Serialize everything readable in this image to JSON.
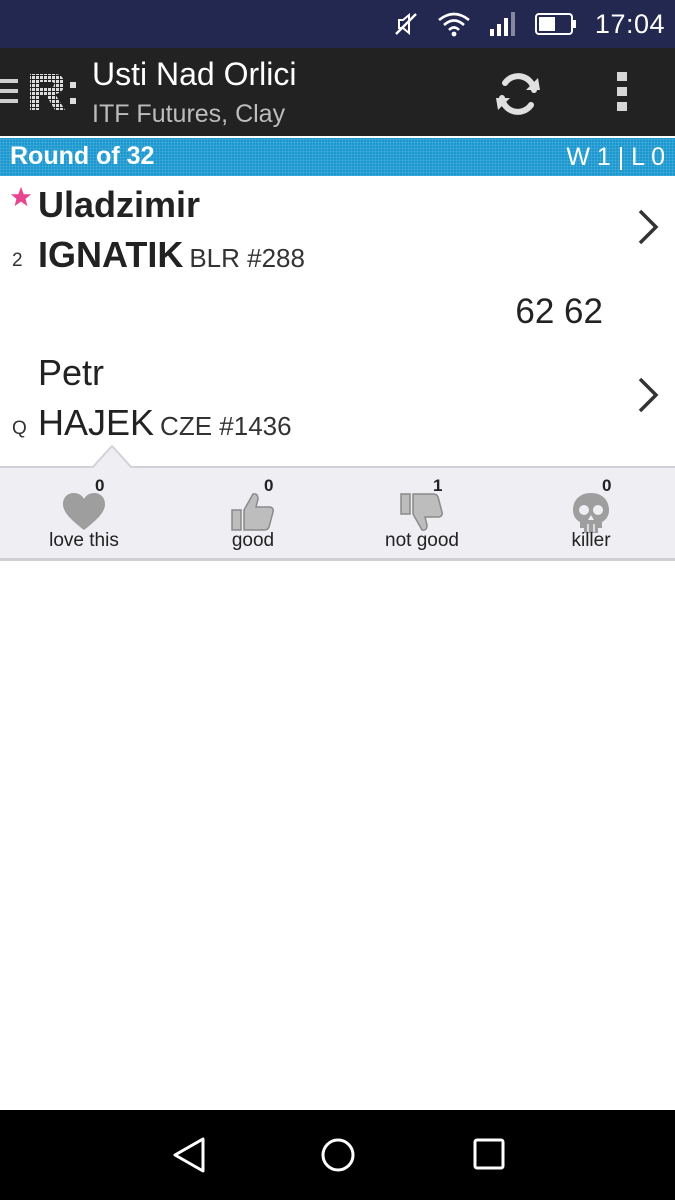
{
  "status_bar": {
    "time": "17:04",
    "icons": [
      "mute-icon",
      "wifi-icon",
      "signal-icon",
      "battery-icon"
    ]
  },
  "app_bar": {
    "title": "Usti Nad Orlici",
    "subtitle": "ITF Futures, Clay",
    "logo_text": "R:",
    "icons": [
      "drawer-icon",
      "refresh-icon",
      "overflow-menu-icon"
    ]
  },
  "round": {
    "label": "Round of 32",
    "record": "W 1 | L 0"
  },
  "match": {
    "score": "62 62",
    "players": [
      {
        "first_name": "Uladzimir",
        "last_name": "IGNATIK",
        "meta": "BLR #288",
        "seed": "2",
        "favorite": true,
        "winner": true
      },
      {
        "first_name": "Petr",
        "last_name": "HAJEK",
        "meta": "CZE #1436",
        "seed": "Q",
        "favorite": false,
        "winner": false
      }
    ]
  },
  "reactions": [
    {
      "label": "love this",
      "count": "0",
      "icon": "heart-icon"
    },
    {
      "label": "good",
      "count": "0",
      "icon": "thumbs-up-icon"
    },
    {
      "label": "not good",
      "count": "1",
      "icon": "thumbs-down-icon"
    },
    {
      "label": "killer",
      "count": "0",
      "icon": "skull-icon"
    }
  ],
  "colors": {
    "status_bar": "#232851",
    "app_bar": "#222222",
    "round_bar": "#1b98cf",
    "favorite_star": "#e9448f",
    "reactions_bg": "#eeeef3",
    "reaction_icon": "#9e9e9e"
  },
  "nav_bar": {
    "icons": [
      "back-icon",
      "home-icon",
      "recents-icon"
    ]
  }
}
